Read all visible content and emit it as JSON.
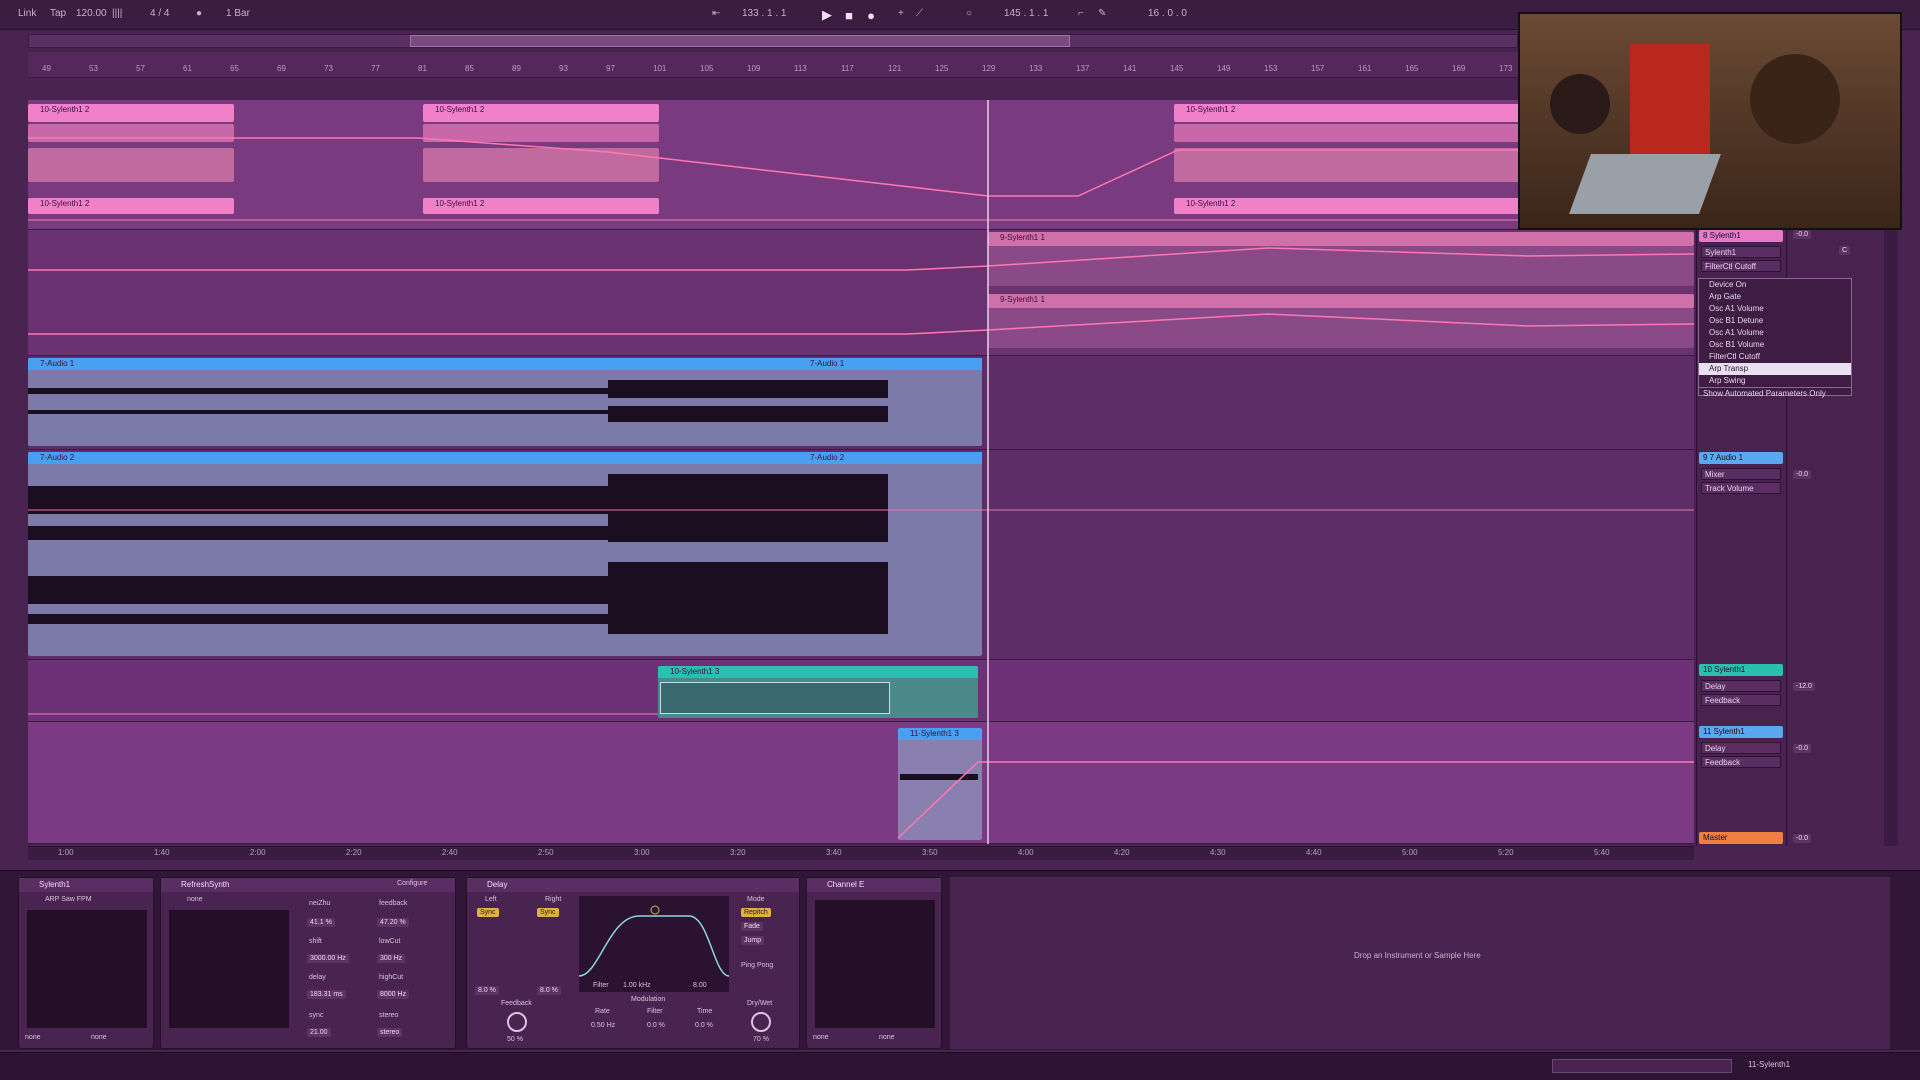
{
  "transport": {
    "link": "Link",
    "tap": "Tap",
    "tempo": "120.00",
    "tempo_nudge": "||||",
    "time_sig": "4 / 4",
    "loop_indicator": "1 Bar",
    "arrangement_position": "133 . 1 . 1",
    "loop_length": "145 . 1 . 1",
    "cpu": "16 . 0 . 0"
  },
  "ruler_ticks": [
    "49",
    "53",
    "57",
    "61",
    "65",
    "69",
    "73",
    "77",
    "81",
    "85",
    "89",
    "93",
    "97",
    "101",
    "105",
    "109",
    "113",
    "117",
    "121",
    "125",
    "129",
    "133",
    "137",
    "141",
    "145",
    "149",
    "153",
    "157",
    "161",
    "165",
    "169",
    "173"
  ],
  "clips": {
    "synth2_a": "10-Sylenth1 2",
    "synth2_b": "10-Sylenth1 2",
    "synth2_c": "10-Sylenth1 2",
    "synth2_d": "10-Sylenth1 2",
    "synth2_e": "10-Sylenth1 2",
    "synth2_f": "10-Sylenth1 2",
    "synth1_a": "9-Sylenth1 1",
    "synth1_b": "9-Sylenth1 1",
    "audio1_a": "7-Audio 1",
    "audio1_b": "7-Audio 1",
    "audio2_a": "7-Audio 2",
    "audio2_b": "7-Audio 2",
    "synth3_a": "10-Sylenth1 3",
    "synth4_a": "11-Sylenth1 3"
  },
  "tracks": [
    {
      "name": "8 Sylenth1",
      "sel1": "Sylenth1",
      "sel2": "FilterCtl Cutoff",
      "color": "#e878c8"
    },
    {
      "name": "9 7 Audio 1",
      "sel1": "Mixer",
      "sel2": "Track Volume",
      "color": "#5aa8f0"
    },
    {
      "name": "10 Sylenth1",
      "sel1": "Delay",
      "sel2": "Feedback",
      "color": "#2ac0b0"
    },
    {
      "name": "11 Sylenth1",
      "sel1": "Delay",
      "sel2": "Feedback",
      "color": "#5aa8f0"
    },
    {
      "name": "Master",
      "sel1": "",
      "sel2": "",
      "color": "#f08040"
    }
  ],
  "mixer_values": {
    "vol1": "-0.0",
    "vol2": "-0.0",
    "vol3": "-12.0",
    "vol4": "-0.0",
    "pan": "C",
    "master_vol": "-0.0"
  },
  "param_menu": {
    "items": [
      "Device On",
      "Arp Gate",
      "Osc A1 Volume",
      "Osc B1 Detune",
      "Osc A1 Volume",
      "Osc B1 Volume",
      "FilterCtl Cutoff",
      "Arp Transp",
      "Arp Swing",
      "Show Automated Parameters Only"
    ],
    "highlighted": 7
  },
  "bottom_ticks": [
    "1:00",
    "1:40",
    "2:00",
    "2:20",
    "2:40",
    "2:50",
    "3:00",
    "3:20",
    "3:40",
    "3:50",
    "4:00",
    "4:20",
    "4:30",
    "4:40",
    "5:00",
    "5:20",
    "5:40"
  ],
  "devices": {
    "dev1": {
      "title": "Sylenth1",
      "preset": "ARP Saw FPM",
      "none1": "none",
      "none2": "none"
    },
    "dev2": {
      "title": "RefreshSynth",
      "preset": "none",
      "configure": "Configure",
      "params": [
        {
          "label": "neiZhu",
          "value": "41.1 %",
          "label2": "feedback",
          "value2": "47.20 %"
        },
        {
          "label": "shift",
          "value": "3000.00 Hz",
          "label2": "lowCut",
          "value2": "300 Hz"
        },
        {
          "label": "delay",
          "value": "183.31 ms",
          "label2": "highCut",
          "value2": "8000 Hz"
        },
        {
          "label": "sync",
          "value": "21.00",
          "label2": "stereo",
          "value2": "stereo"
        }
      ]
    },
    "dev3": {
      "title": "Delay",
      "left": "Left",
      "right": "Right",
      "sync": "Sync",
      "sync_r": "Sync",
      "l_val": "8.0 %",
      "r_val": "8.0 %",
      "feedback": "Feedback",
      "feedback_val": "50 %",
      "mode": "Mode",
      "repitch": "Repitch",
      "fade": "Fade",
      "jump": "Jump",
      "pingpong": "Ping Pong",
      "filter": "Filter",
      "freq": "1.00 kHz",
      "width": "8.00",
      "modulation": "Modulation",
      "rate": "Rate",
      "rate_val": "0.50 Hz",
      "filter_mod": "Filter",
      "filter_mod_val": "0.0 %",
      "time": "Time",
      "time_val": "0.0 %",
      "dry_wet": "Dry/Wet",
      "dw_val": "70 %"
    },
    "dev4": {
      "title": "Channel E",
      "none1": "none",
      "none2": "none"
    }
  },
  "drop_hint": "Drop an Instrument or Sample Here",
  "status_right": "11-Sylenth1"
}
